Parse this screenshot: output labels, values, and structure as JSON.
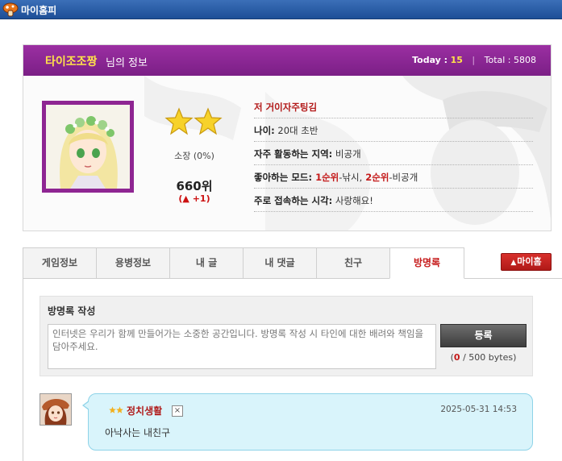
{
  "window": {
    "title": "마이홈피"
  },
  "profile": {
    "name": "타이조조짱",
    "name_suffix": "님의 정보",
    "today_label": "Today :",
    "today_value": "15",
    "total_label": "Total : 5808",
    "grade_stars": 2,
    "grade_text": "소장 (0%)",
    "rank": "660위",
    "rank_change": "(▲ +1)",
    "info": {
      "headline": "저 거이자주팅김",
      "age_label": "나이:",
      "age_value": " 20대 초반",
      "activity_label": "자주 활동하는 지역:",
      "activity_value": " 비공개",
      "mode_label": "좋아하는 모드:",
      "mode_first_rank": " 1순위",
      "mode_first_value": "-낚시,",
      "mode_second_rank": " 2순위",
      "mode_second_value": "-비공개",
      "time_label": "주로 접속하는 시각:",
      "time_value": " 사랑해요!"
    }
  },
  "tabs": [
    {
      "label": "게임정보"
    },
    {
      "label": "용병정보"
    },
    {
      "label": "내 글"
    },
    {
      "label": "내 댓글"
    },
    {
      "label": "친구"
    },
    {
      "label": "방명록",
      "active": true
    }
  ],
  "myhome_button": {
    "label": "마이홈"
  },
  "guestbook": {
    "heading": "방명록 작성",
    "placeholder": "인터넷은 우리가 함께 만들어가는 소중한 공간입니다. 방명록 작성 시 타인에 대한 배려와 책임을 담아주세요.",
    "submit_label": "등록",
    "byte_open": "(",
    "byte_count": "0",
    "byte_rest": " / 500 bytes)"
  },
  "entries": [
    {
      "writer": "정치생활",
      "delete_icon": "×",
      "date": "2025-05-31 14:53",
      "message": "아낙사는 내친구"
    }
  ],
  "colors": {
    "header_purple": "#8b2893",
    "accent_yellow": "#ffe24a",
    "accent_red": "#c41a1a",
    "bubble_bg": "#d9f4fb",
    "titlebar_blue": "#1d4f97"
  }
}
